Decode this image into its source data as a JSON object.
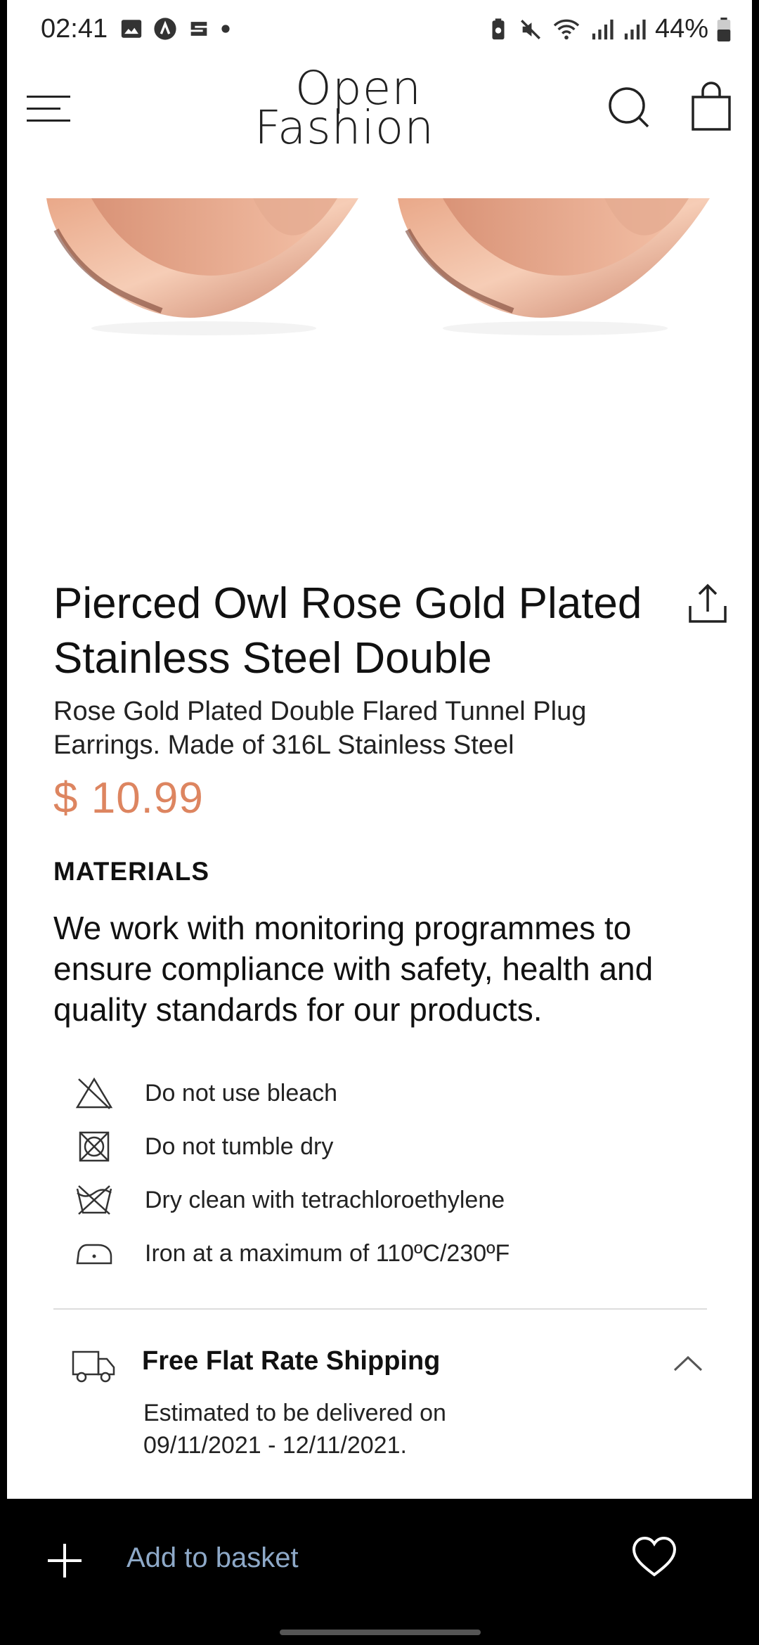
{
  "status_bar": {
    "time": "02:41",
    "battery": "44%"
  },
  "header": {
    "logo_line1": "Open",
    "logo_line2": "Fashion"
  },
  "product": {
    "title": "Pierced Owl Rose Gold Plated Stainless Steel Double",
    "description": "Rose Gold Plated Double Flared Tunnel Plug Earrings. Made of 316L Stainless Steel",
    "price": "$ 10.99",
    "price_color": "#dd8560"
  },
  "materials": {
    "heading": "MATERIALS",
    "text": "We work with monitoring programmes to ensure compliance with safety, health and quality standards for our products."
  },
  "care": [
    {
      "icon": "no-bleach-icon",
      "label": "Do not use bleach"
    },
    {
      "icon": "no-tumble-dry-icon",
      "label": "Do not tumble dry"
    },
    {
      "icon": "dry-clean-icon",
      "label": "Dry clean with tetrachloroethylene"
    },
    {
      "icon": "iron-icon",
      "label": "Iron at a maximum of 110ºC/230ºF"
    }
  ],
  "shipping": {
    "title": "Free Flat Rate Shipping",
    "description": "Estimated to be delivered on 09/11/2021 - 12/11/2021."
  },
  "bottom_bar": {
    "add_label": "Add to basket",
    "label_color": "#8ea9c8"
  }
}
